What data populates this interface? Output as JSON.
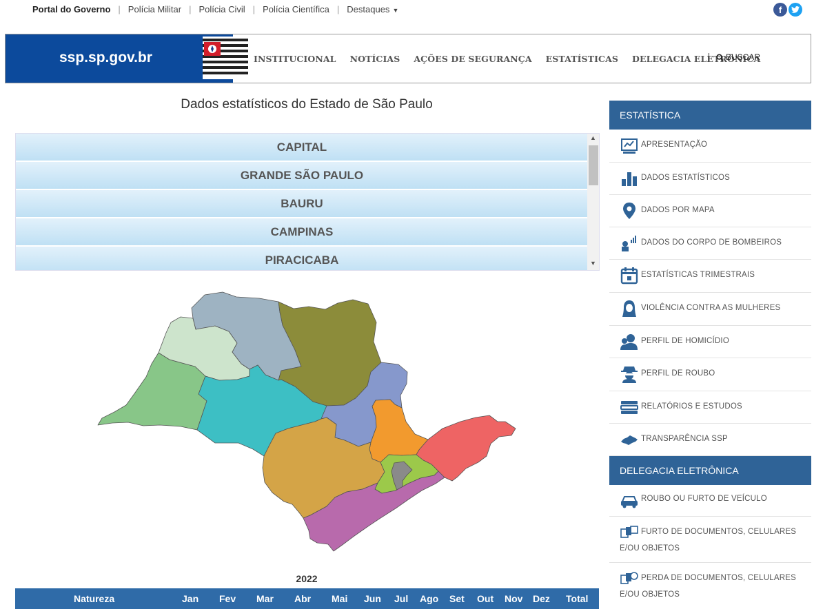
{
  "top_links": [
    {
      "label": "Portal do Governo"
    },
    {
      "label": "Polícia Militar"
    },
    {
      "label": "Polícia Civil"
    },
    {
      "label": "Polícia Científica"
    },
    {
      "label": "Destaques"
    }
  ],
  "brand": {
    "name": "ssp.sp.gov.br"
  },
  "nav": [
    "INSTITUCIONAL",
    "NOTÍCIAS",
    "AÇÕES DE SEGURANÇA",
    "ESTATÍSTICAS",
    "DELEGACIA ELETRÔNICA"
  ],
  "search_label": "BUSCAR",
  "page_title": "Dados estatísticos do Estado de São Paulo",
  "regions": [
    "CAPITAL",
    "GRANDE SÃO PAULO",
    "BAURU",
    "CAMPINAS",
    "PIRACICABA"
  ],
  "map_colors": {
    "presidente_prudente": "#88c688",
    "aracatuba": "#cde4cc",
    "sao_jose_rio_preto": "#9eb3c2",
    "ribeirao_preto": "#8c8c3a",
    "bauru": "#3dbfc4",
    "araraquara": "#8698cc",
    "campinas": "#f29a2e",
    "sorocaba": "#d4a447",
    "sao_jose_campos": "#ee6464",
    "grande_sp": "#9cc94a",
    "capital": "#8a8a8a",
    "santos": "#b86aac"
  },
  "table": {
    "year": "2022",
    "headers": [
      "Natureza",
      "Jan",
      "Fev",
      "Mar",
      "Abr",
      "Mai",
      "Jun",
      "Jul",
      "Ago",
      "Set",
      "Out",
      "Nov",
      "Dez",
      "Total"
    ]
  },
  "sidebar": {
    "estatistica_title": "ESTATÍSTICA",
    "estatistica_items": [
      {
        "label": "APRESENTAÇÃO",
        "icon": "presentation-icon"
      },
      {
        "label": "DADOS ESTATÍSTICOS",
        "icon": "bar-chart-icon"
      },
      {
        "label": "DADOS POR MAPA",
        "icon": "map-pin-icon"
      },
      {
        "label": "DADOS DO CORPO DE BOMBEIROS",
        "icon": "firefighter-icon"
      },
      {
        "label": "ESTATÍSTICAS TRIMESTRAIS",
        "icon": "calendar-icon"
      },
      {
        "label": "VIOLÊNCIA CONTRA AS MULHERES",
        "icon": "woman-icon"
      },
      {
        "label": "PERFIL DE HOMICÍDIO",
        "icon": "people-icon"
      },
      {
        "label": "PERFIL DE ROUBO",
        "icon": "robber-icon"
      },
      {
        "label": "RELATÓRIOS E ESTUDOS",
        "icon": "books-icon"
      },
      {
        "label": "TRANSPARÊNCIA SSP",
        "icon": "state-map-icon"
      }
    ],
    "delegacia_title": "DELEGACIA ELETRÔNICA",
    "delegacia_items": [
      {
        "label": "ROUBO OU FURTO DE VEÍCULO",
        "icon": "car-icon"
      },
      {
        "label": "FURTO DE DOCUMENTOS, CELULARES E/OU OBJETOS",
        "icon": "documents-icon"
      },
      {
        "label": "PERDA DE DOCUMENTOS, CELULARES E/OU OBJETOS",
        "icon": "lost-documents-icon"
      }
    ]
  },
  "colors": {
    "brand_blue": "#0c4a9c",
    "sidebar_header": "#2f6397",
    "table_header": "#2f6ba8",
    "icon": "#2f6397"
  }
}
